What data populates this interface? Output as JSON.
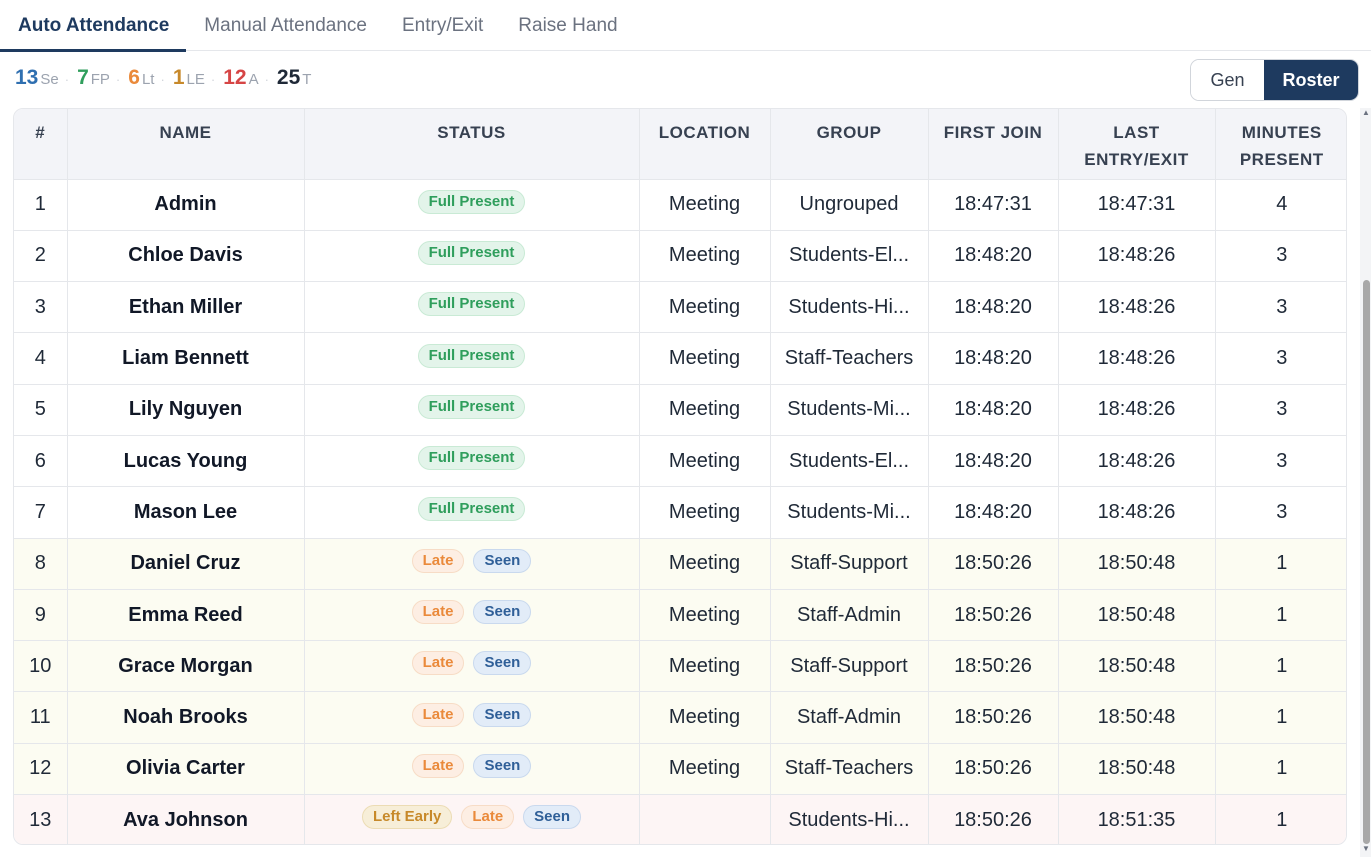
{
  "tabs": [
    {
      "label": "Auto Attendance",
      "active": true
    },
    {
      "label": "Manual Attendance",
      "active": false
    },
    {
      "label": "Entry/Exit",
      "active": false
    },
    {
      "label": "Raise Hand",
      "active": false
    }
  ],
  "stats": [
    {
      "num": "13",
      "lbl": "Se",
      "color": "#2f6fb0"
    },
    {
      "num": "7",
      "lbl": "FP",
      "color": "#2f9e5c"
    },
    {
      "num": "6",
      "lbl": "Lt",
      "color": "#ea8a3b"
    },
    {
      "num": "1",
      "lbl": "LE",
      "color": "#c7892a"
    },
    {
      "num": "12",
      "lbl": "A",
      "color": "#d64545"
    },
    {
      "num": "25",
      "lbl": "T",
      "color": "#1f2937"
    }
  ],
  "view_toggle": {
    "gen_label": "Gen",
    "roster_label": "Roster"
  },
  "table": {
    "headers": {
      "num": "#",
      "name": "NAME",
      "status": "STATUS",
      "location": "LOCATION",
      "group": "GROUP",
      "first_join": "FIRST JOIN",
      "last_entry_1": "LAST",
      "last_entry_2": "ENTRY/EXIT",
      "minutes_1": "MINUTES",
      "minutes_2": "PRESENT"
    },
    "rows": [
      {
        "num": "1",
        "name": "Admin",
        "status": [
          "Full Present"
        ],
        "location": "Meeting",
        "group": "Ungrouped",
        "first_join": "18:47:31",
        "last": "18:47:31",
        "minutes": "4",
        "kind": "full"
      },
      {
        "num": "2",
        "name": "Chloe Davis",
        "status": [
          "Full Present"
        ],
        "location": "Meeting",
        "group": "Students-El...",
        "first_join": "18:48:20",
        "last": "18:48:26",
        "minutes": "3",
        "kind": "full"
      },
      {
        "num": "3",
        "name": "Ethan Miller",
        "status": [
          "Full Present"
        ],
        "location": "Meeting",
        "group": "Students-Hi...",
        "first_join": "18:48:20",
        "last": "18:48:26",
        "minutes": "3",
        "kind": "full"
      },
      {
        "num": "4",
        "name": "Liam Bennett",
        "status": [
          "Full Present"
        ],
        "location": "Meeting",
        "group": "Staff-Teachers",
        "first_join": "18:48:20",
        "last": "18:48:26",
        "minutes": "3",
        "kind": "full"
      },
      {
        "num": "5",
        "name": "Lily Nguyen",
        "status": [
          "Full Present"
        ],
        "location": "Meeting",
        "group": "Students-Mi...",
        "first_join": "18:48:20",
        "last": "18:48:26",
        "minutes": "3",
        "kind": "full"
      },
      {
        "num": "6",
        "name": "Lucas Young",
        "status": [
          "Full Present"
        ],
        "location": "Meeting",
        "group": "Students-El...",
        "first_join": "18:48:20",
        "last": "18:48:26",
        "minutes": "3",
        "kind": "full"
      },
      {
        "num": "7",
        "name": "Mason Lee",
        "status": [
          "Full Present"
        ],
        "location": "Meeting",
        "group": "Students-Mi...",
        "first_join": "18:48:20",
        "last": "18:48:26",
        "minutes": "3",
        "kind": "full"
      },
      {
        "num": "8",
        "name": "Daniel Cruz",
        "status": [
          "Late",
          "Seen"
        ],
        "location": "Meeting",
        "group": "Staff-Support",
        "first_join": "18:50:26",
        "last": "18:50:48",
        "minutes": "1",
        "kind": "late"
      },
      {
        "num": "9",
        "name": "Emma Reed",
        "status": [
          "Late",
          "Seen"
        ],
        "location": "Meeting",
        "group": "Staff-Admin",
        "first_join": "18:50:26",
        "last": "18:50:48",
        "minutes": "1",
        "kind": "late"
      },
      {
        "num": "10",
        "name": "Grace Morgan",
        "status": [
          "Late",
          "Seen"
        ],
        "location": "Meeting",
        "group": "Staff-Support",
        "first_join": "18:50:26",
        "last": "18:50:48",
        "minutes": "1",
        "kind": "late"
      },
      {
        "num": "11",
        "name": "Noah Brooks",
        "status": [
          "Late",
          "Seen"
        ],
        "location": "Meeting",
        "group": "Staff-Admin",
        "first_join": "18:50:26",
        "last": "18:50:48",
        "minutes": "1",
        "kind": "late"
      },
      {
        "num": "12",
        "name": "Olivia Carter",
        "status": [
          "Late",
          "Seen"
        ],
        "location": "Meeting",
        "group": "Staff-Teachers",
        "first_join": "18:50:26",
        "last": "18:50:48",
        "minutes": "1",
        "kind": "late"
      },
      {
        "num": "13",
        "name": "Ava Johnson",
        "status": [
          "Left Early",
          "Late",
          "Seen"
        ],
        "location": "",
        "group": "Students-Hi...",
        "first_join": "18:50:26",
        "last": "18:51:35",
        "minutes": "1",
        "kind": "left"
      }
    ]
  }
}
